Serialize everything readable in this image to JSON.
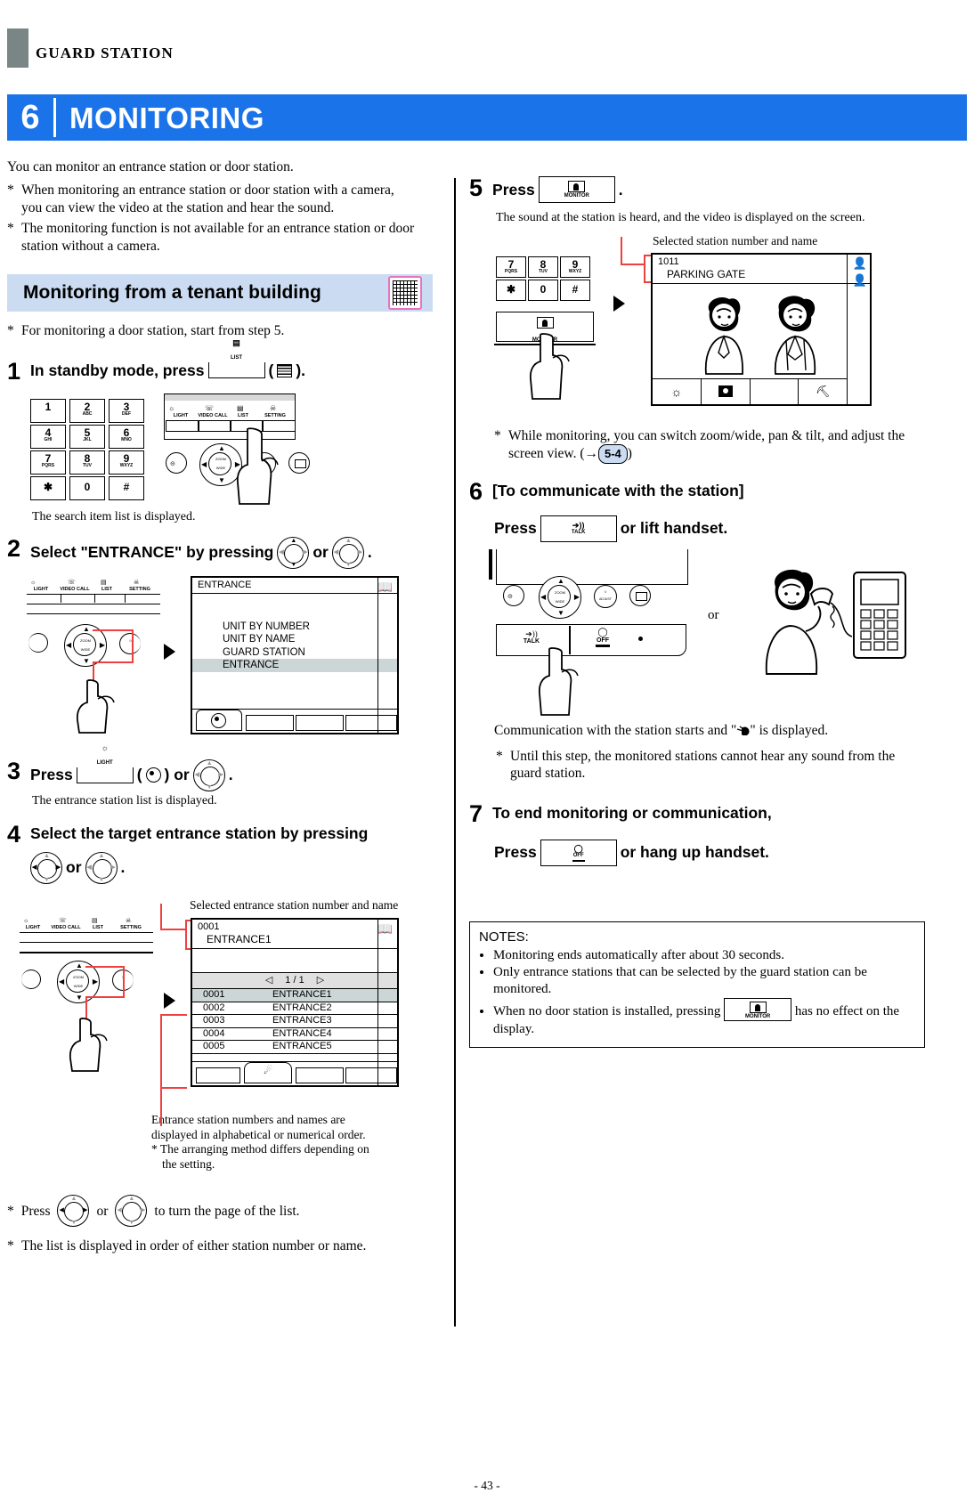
{
  "header": {
    "running_head": "GUARD STATION",
    "chapter_number": "6",
    "chapter_title": "MONITORING",
    "accent_color": "#1a73e8"
  },
  "intro": {
    "lead": "You can monitor an entrance station or door station.",
    "note1": "When monitoring an entrance station or door station with a camera, you can view the video at the station and hear the sound.",
    "note2": "The monitoring function is not available for an entrance station or door station without a camera."
  },
  "section": {
    "title": "Monitoring from a tenant building",
    "icon": "tenant-building-icon",
    "banner_color": "#cbdcf2",
    "icon_border_color": "#e673c0",
    "note": "For monitoring a door station, start from step 5."
  },
  "steps": {
    "s1": {
      "number": "1",
      "text_a": "In standby mode, press",
      "key_caption": "LIST",
      "text_b": "(",
      "text_c": ").",
      "result": "The search item list is displayed."
    },
    "s2": {
      "number": "2",
      "text_a": "Select \"ENTRANCE\" by pressing",
      "text_or": "or",
      "text_end": "."
    },
    "s3": {
      "number": "3",
      "text_a": "Press",
      "key_caption": "LIGHT",
      "text_b": "(",
      "text_c": ") or",
      "text_end": ".",
      "result": "The entrance station list is displayed."
    },
    "s4": {
      "number": "4",
      "text_a": "Select the target entrance station by pressing",
      "text_or": "or",
      "text_end": ".",
      "callout": "Selected entrance station number and name",
      "note_list_1": "Entrance station numbers and names are",
      "note_list_2": "displayed in alphabetical or numerical order.",
      "note_list_3": "* The arranging method differs depending on",
      "note_list_4": "the setting.",
      "footnote_a": "Press",
      "footnote_a_end": "to turn the page of the list.",
      "footnote_b": "The list is displayed in order of either station number or name."
    },
    "s5": {
      "number": "5",
      "text_a": "Press",
      "key_caption": "MONITOR",
      "text_end": ".",
      "result": "The sound at the station is heard, and the video is displayed on the screen.",
      "callout": "Selected station number and name",
      "note_a": "While monitoring, you can switch zoom/wide, pan & tilt, and adjust the screen view. (",
      "note_arrow": "→",
      "note_ref": "5-4",
      "note_b": ")"
    },
    "s6": {
      "number": "6",
      "heading": "[To communicate with the station]",
      "text_a": "Press",
      "key_caption": "TALK",
      "text_b": "or lift handset.",
      "text_or": "or",
      "result": "Communication with the station starts and \"",
      "result_b": "\" is displayed.",
      "note": "Until this step, the monitored stations cannot hear any sound from the guard station."
    },
    "s7": {
      "number": "7",
      "heading": "To end monitoring or communication,",
      "text_a": "Press",
      "key_caption": "OFF",
      "text_b": "or hang up handset."
    }
  },
  "keypad": {
    "keys": [
      {
        "n": "1",
        "l": ""
      },
      {
        "n": "2",
        "l": "ABC"
      },
      {
        "n": "3",
        "l": "DEF"
      },
      {
        "n": "4",
        "l": "GHI"
      },
      {
        "n": "5",
        "l": "JKL"
      },
      {
        "n": "6",
        "l": "MNO"
      },
      {
        "n": "7",
        "l": "PQRS"
      },
      {
        "n": "8",
        "l": "TUV"
      },
      {
        "n": "9",
        "l": "WXYZ"
      },
      {
        "n": "✱",
        "l": ""
      },
      {
        "n": "0",
        "l": ""
      },
      {
        "n": "#",
        "l": ""
      }
    ],
    "function_keys": [
      "LIGHT",
      "VIDEO CALL",
      "LIST",
      "SETTING"
    ],
    "zoom_label_1": "ZOOM",
    "zoom_label_2": "WIDE",
    "adjust_label_1": "☼/✺",
    "adjust_label_2": "ADJUST"
  },
  "screens": {
    "entrance_menu": {
      "title": "ENTRANCE",
      "items": [
        "UNIT BY NUMBER",
        "UNIT BY NAME",
        "GUARD STATION",
        "ENTRANCE"
      ],
      "selected_index": 3
    },
    "entrance_list": {
      "header_number": "0001",
      "header_name": "ENTRANCE1",
      "page_indicator": "1 / 1",
      "prev_arrow": "◁",
      "next_arrow": "▷",
      "rows": [
        {
          "number": "0001",
          "name": "ENTRANCE1"
        },
        {
          "number": "0002",
          "name": "ENTRANCE2"
        },
        {
          "number": "0003",
          "name": "ENTRANCE3"
        },
        {
          "number": "0004",
          "name": "ENTRANCE4"
        },
        {
          "number": "0005",
          "name": "ENTRANCE5"
        }
      ],
      "selected_index": 0
    },
    "monitor_view": {
      "station_number": "1011",
      "station_name": "PARKING GATE"
    }
  },
  "notes_box": {
    "title": "NOTES:",
    "items": [
      "Monitoring ends automatically after about 30 seconds.",
      "Only entrance stations that can be selected by the guard station can be monitored.",
      "When no door station is installed, pressing"
    ],
    "item3_tail": "has no effect on the display.",
    "item3_key": "MONITOR"
  },
  "footer": {
    "page": "- 43 -"
  }
}
